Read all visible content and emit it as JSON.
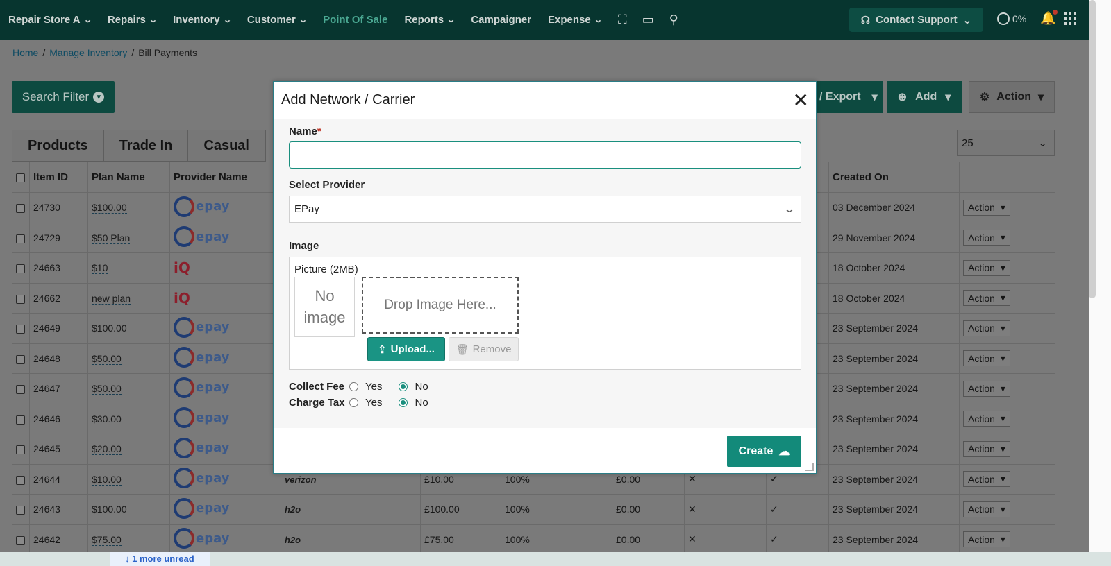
{
  "nav": {
    "items": [
      {
        "label": "Repair Store A",
        "chevron": true,
        "active": false
      },
      {
        "label": "Repairs",
        "chevron": true,
        "active": false
      },
      {
        "label": "Inventory",
        "chevron": true,
        "active": false
      },
      {
        "label": "Customer",
        "chevron": true,
        "active": false
      },
      {
        "label": "Point Of Sale",
        "chevron": false,
        "active": true
      },
      {
        "label": "Reports",
        "chevron": true,
        "active": false
      },
      {
        "label": "Campaigner",
        "chevron": false,
        "active": false
      },
      {
        "label": "Expense",
        "chevron": true,
        "active": false
      }
    ],
    "contact_support": "Contact Support",
    "progress": "0%"
  },
  "breadcrumb": {
    "home": "Home",
    "manage": "Manage Inventory",
    "current": "Bill Payments"
  },
  "toolbar": {
    "search_filter": "Search Filter",
    "export": "/ Export",
    "add": "Add",
    "action": "Action"
  },
  "tabs": [
    "Products",
    "Trade In",
    "Casual"
  ],
  "page_size": "25",
  "table": {
    "headers": {
      "item_id": "Item ID",
      "plan_name": "Plan Name",
      "provider_name": "Provider Name",
      "created_on": "Created On"
    },
    "rows": [
      {
        "id": "24730",
        "plan": "$100.00",
        "provider": "epay",
        "carrier": "",
        "price": "",
        "pct": "",
        "fee": "",
        "x": "",
        "check": "",
        "created": "03 December 2024"
      },
      {
        "id": "24729",
        "plan": "$50 Plan",
        "provider": "epay",
        "carrier": "",
        "price": "",
        "pct": "",
        "fee": "",
        "x": "",
        "check": "",
        "created": "29 November 2024"
      },
      {
        "id": "24663",
        "plan": "$10",
        "provider": "iQ",
        "carrier": "",
        "price": "",
        "pct": "",
        "fee": "",
        "x": "",
        "check": "",
        "created": "18 October 2024"
      },
      {
        "id": "24662",
        "plan": "new plan",
        "provider": "iQ",
        "carrier": "",
        "price": "",
        "pct": "",
        "fee": "",
        "x": "",
        "check": "",
        "created": "18 October 2024"
      },
      {
        "id": "24649",
        "plan": "$100.00",
        "provider": "epay",
        "carrier": "",
        "price": "",
        "pct": "",
        "fee": "",
        "x": "",
        "check": "",
        "created": "23 September 2024"
      },
      {
        "id": "24648",
        "plan": "$50.00",
        "provider": "epay",
        "carrier": "",
        "price": "",
        "pct": "",
        "fee": "",
        "x": "",
        "check": "",
        "created": "23 September 2024"
      },
      {
        "id": "24647",
        "plan": "$50.00",
        "provider": "epay",
        "carrier": "",
        "price": "",
        "pct": "",
        "fee": "",
        "x": "",
        "check": "",
        "created": "23 September 2024"
      },
      {
        "id": "24646",
        "plan": "$30.00",
        "provider": "epay",
        "carrier": "",
        "price": "",
        "pct": "",
        "fee": "",
        "x": "",
        "check": "",
        "created": "23 September 2024"
      },
      {
        "id": "24645",
        "plan": "$20.00",
        "provider": "epay",
        "carrier": "",
        "price": "",
        "pct": "",
        "fee": "",
        "x": "",
        "check": "",
        "created": "23 September 2024"
      },
      {
        "id": "24644",
        "plan": "$10.00",
        "provider": "epay",
        "carrier": "verizon",
        "price": "£10.00",
        "pct": "100%",
        "fee": "£0.00",
        "x": "✕",
        "check": "✓",
        "created": "23 September 2024"
      },
      {
        "id": "24643",
        "plan": "$100.00",
        "provider": "epay",
        "carrier": "h2o",
        "price": "£100.00",
        "pct": "100%",
        "fee": "£0.00",
        "x": "✕",
        "check": "✓",
        "created": "23 September 2024"
      },
      {
        "id": "24642",
        "plan": "$75.00",
        "provider": "epay",
        "carrier": "h2o",
        "price": "£75.00",
        "pct": "100%",
        "fee": "£0.00",
        "x": "✕",
        "check": "✓",
        "created": "23 September 2024"
      }
    ],
    "row_action": "Action"
  },
  "modal": {
    "title": "Add Network / Carrier",
    "name_label": "Name",
    "name_required": "*",
    "name_value": "",
    "provider_label": "Select Provider",
    "provider_value": "EPay",
    "image_label": "Image",
    "picture_label": "Picture (2MB)",
    "no_image": "No image",
    "drop_zone": "Drop Image Here...",
    "upload": "Upload...",
    "remove": "Remove",
    "collect_fee_label": "Collect Fee",
    "charge_tax_label": "Charge Tax",
    "yes": "Yes",
    "no": "No",
    "collect_fee_value": "No",
    "charge_tax_value": "No",
    "create": "Create"
  },
  "notification": {
    "unread": "1 more unread"
  },
  "colors": {
    "nav_bg": "#07352f",
    "accent": "#138a7a",
    "active_nav": "#4aa892"
  }
}
